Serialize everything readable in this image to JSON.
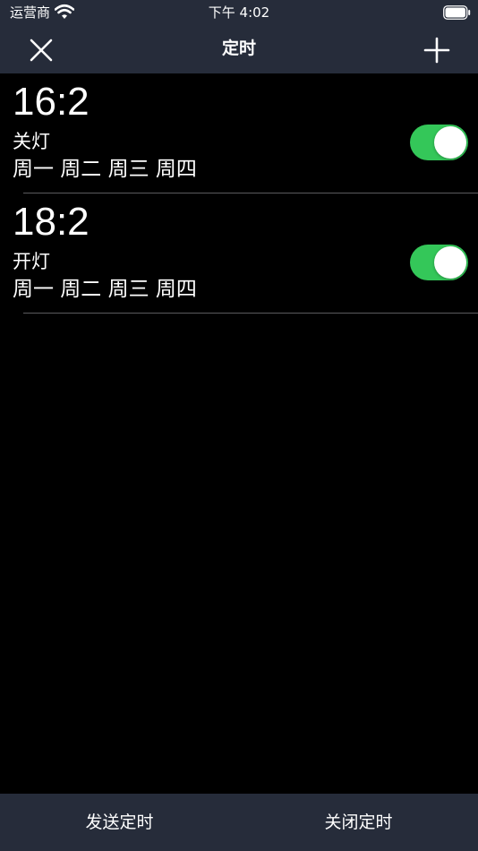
{
  "status_bar": {
    "carrier": "运营商",
    "time": "下午 4:02"
  },
  "nav": {
    "title": "定时",
    "left_icon": "close-icon",
    "right_icon": "plus-icon"
  },
  "timers": [
    {
      "time": "16:2",
      "action": "关灯",
      "days": "周一 周二 周三 周四",
      "enabled": true
    },
    {
      "time": "18:2",
      "action": "开灯",
      "days": "周一 周二 周三 周四",
      "enabled": true
    }
  ],
  "bottom_bar": {
    "send_label": "发送定时",
    "close_label": "关闭定时"
  },
  "colors": {
    "bar_background": "#262c3a",
    "content_background": "#000000",
    "toggle_on": "#34c759",
    "text": "#ffffff"
  }
}
